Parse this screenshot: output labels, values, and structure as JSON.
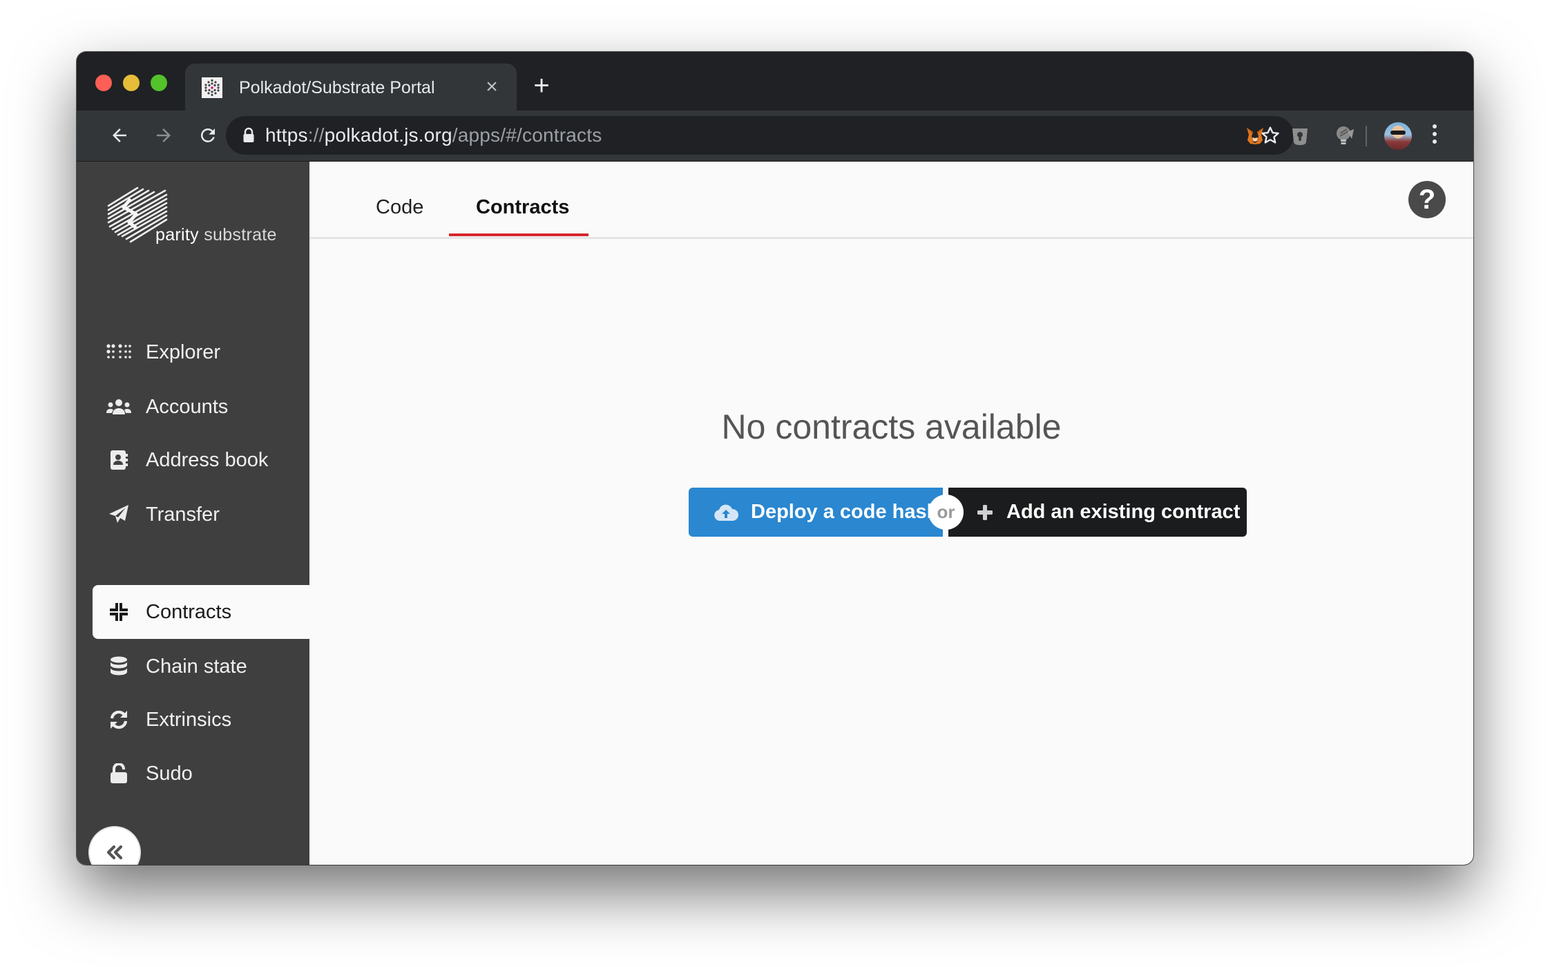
{
  "browser": {
    "tab_title": "Polkadot/Substrate Portal",
    "url": {
      "scheme": "https",
      "separator": "://",
      "host": "polkadot.js.org",
      "path": "/apps/#/contracts"
    },
    "icons": {
      "back": "arrow-left-icon",
      "forward": "arrow-right-icon",
      "reload": "reload-icon",
      "lock": "lock-icon",
      "bookmark": "star-icon",
      "extensions": [
        "metamask-fox-icon",
        "keyhole-shield-icon",
        "lightbulb-extension-icon"
      ],
      "profile": "profile-avatar",
      "menu": "kebab-menu-icon"
    }
  },
  "sidebar": {
    "logo": {
      "brand": "parity",
      "product": "substrate"
    },
    "items": [
      {
        "label": "Explorer",
        "icon": "braille-dots-icon",
        "active": false
      },
      {
        "label": "Accounts",
        "icon": "users-icon",
        "active": false
      },
      {
        "label": "Address book",
        "icon": "address-book-icon",
        "active": false
      },
      {
        "label": "Transfer",
        "icon": "paper-plane-icon",
        "active": false
      },
      {
        "label": "Contracts",
        "icon": "compress-icon",
        "active": true
      },
      {
        "label": "Chain state",
        "icon": "database-icon",
        "active": false
      },
      {
        "label": "Extrinsics",
        "icon": "sync-icon",
        "active": false
      },
      {
        "label": "Sudo",
        "icon": "unlock-icon",
        "active": false
      }
    ],
    "collapse_icon": "angle-double-left-icon"
  },
  "main": {
    "tabs": [
      {
        "label": "Code",
        "active": false
      },
      {
        "label": "Contracts",
        "active": true
      }
    ],
    "help_icon": "question-circle-icon",
    "empty_message": "No contracts available",
    "actions": {
      "deploy_label": "Deploy a code hash",
      "or_label": "or",
      "add_label": "Add an existing contract"
    }
  },
  "colors": {
    "accent_red": "#d8262d",
    "deploy_blue": "#2a87d0",
    "add_black": "#1b1c1d",
    "sidebar_bg": "#3f3f3f"
  }
}
